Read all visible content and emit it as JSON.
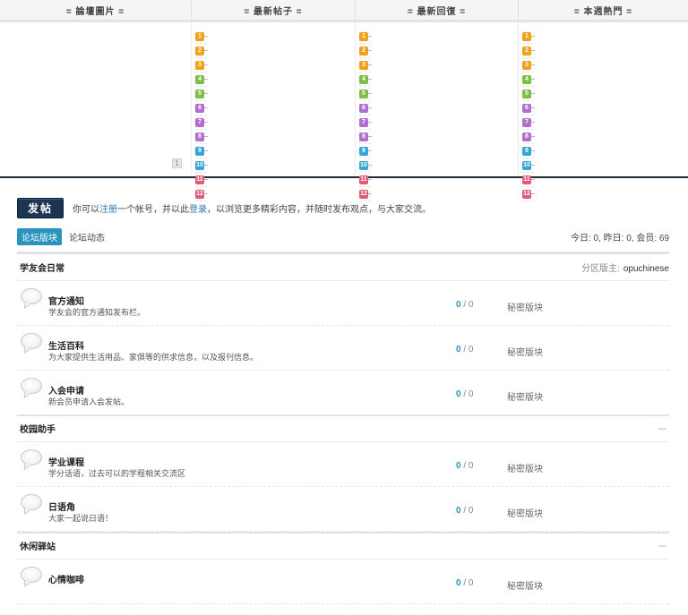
{
  "portal": {
    "headers": [
      "= 論壇圖片 =",
      "= 最新帖子 =",
      "= 最新回復 =",
      "= 本週熱門 ="
    ],
    "pager_label": "1",
    "badge_colors": [
      "#f0a21c",
      "#f0a21c",
      "#f0a21c",
      "#7cbf47",
      "#7cbf47",
      "#b36fd0",
      "#b36fd0",
      "#b36fd0",
      "#36a5d6",
      "#36a5d6",
      "#e05a7a",
      "#e05a7a"
    ],
    "badge_numbers": [
      "1",
      "2",
      "3",
      "4",
      "5",
      "6",
      "7",
      "8",
      "9",
      "10",
      "11",
      "12"
    ]
  },
  "post": {
    "button_label": "发帖",
    "tip_before": "你可以",
    "tip_register": "注册",
    "tip_mid": "一个帐号，并以此",
    "tip_login": "登录",
    "tip_after": "，以浏览更多精彩内容，并随时发布观点，与大家交流。"
  },
  "tabs": {
    "active": "论坛版块",
    "inactive": "论坛动态"
  },
  "stats": "今日: 0, 昨日: 0, 会员: 69",
  "sections": [
    {
      "title": "学友会日常",
      "moderator_label": "分区版主:",
      "moderator": "opuchinese",
      "forums": [
        {
          "name": "官方通知",
          "desc": "学友会的官方通知发布栏。",
          "topics": "0",
          "posts": "0",
          "last": "秘密版块"
        },
        {
          "name": "生活百科",
          "desc": "为大家提供生活用品、家俱等的供求信息，以及报刊信息。",
          "topics": "0",
          "posts": "0",
          "last": "秘密版块"
        },
        {
          "name": "入会申请",
          "desc": "新会员申请入会发帖。",
          "topics": "0",
          "posts": "0",
          "last": "秘密版块"
        }
      ]
    },
    {
      "title": "校园助手",
      "forums": [
        {
          "name": "学业课程",
          "desc": "学分话语，过去可以的学程相关交流区",
          "topics": "0",
          "posts": "0",
          "last": "秘密版块"
        },
        {
          "name": "日语角",
          "desc": "大家一起说日语！",
          "topics": "0",
          "posts": "0",
          "last": "秘密版块"
        }
      ]
    },
    {
      "title": "休闲驿站",
      "forums": [
        {
          "name": "心情咖啡",
          "desc": "",
          "topics": "0",
          "posts": "0",
          "last": "秘密版块"
        }
      ]
    }
  ]
}
